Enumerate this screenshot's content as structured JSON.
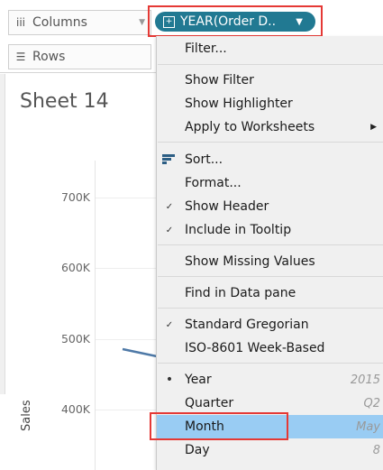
{
  "shelves": {
    "columns": {
      "label": "Columns",
      "icon": "columns-icon"
    },
    "rows": {
      "label": "Rows",
      "icon": "rows-icon"
    }
  },
  "pill": {
    "label": "YEAR(Order D..",
    "color": "#217992"
  },
  "sheet": {
    "title": "Sheet 14",
    "ylabel": "Sales",
    "yticks": [
      "700K",
      "600K",
      "500K",
      "400K"
    ]
  },
  "menu": {
    "filter": "Filter...",
    "show_filter": "Show Filter",
    "show_highlighter": "Show Highlighter",
    "apply_to_worksheets": "Apply to Worksheets",
    "sort": "Sort...",
    "format": "Format...",
    "show_header": "Show Header",
    "include_in_tooltip": "Include in Tooltip",
    "show_missing_values": "Show Missing Values",
    "find_in_data_pane": "Find in Data pane",
    "standard_gregorian": "Standard Gregorian",
    "iso_week": "ISO-8601 Week-Based",
    "year": {
      "label": "Year",
      "value": "2015"
    },
    "quarter": {
      "label": "Quarter",
      "value": "Q2"
    },
    "month": {
      "label": "Month",
      "value": "May"
    },
    "day": {
      "label": "Day",
      "value": "8"
    }
  },
  "colors": {
    "highlight": "#99ccf3",
    "annotation": "#e53935",
    "line": "#4e79a7"
  }
}
